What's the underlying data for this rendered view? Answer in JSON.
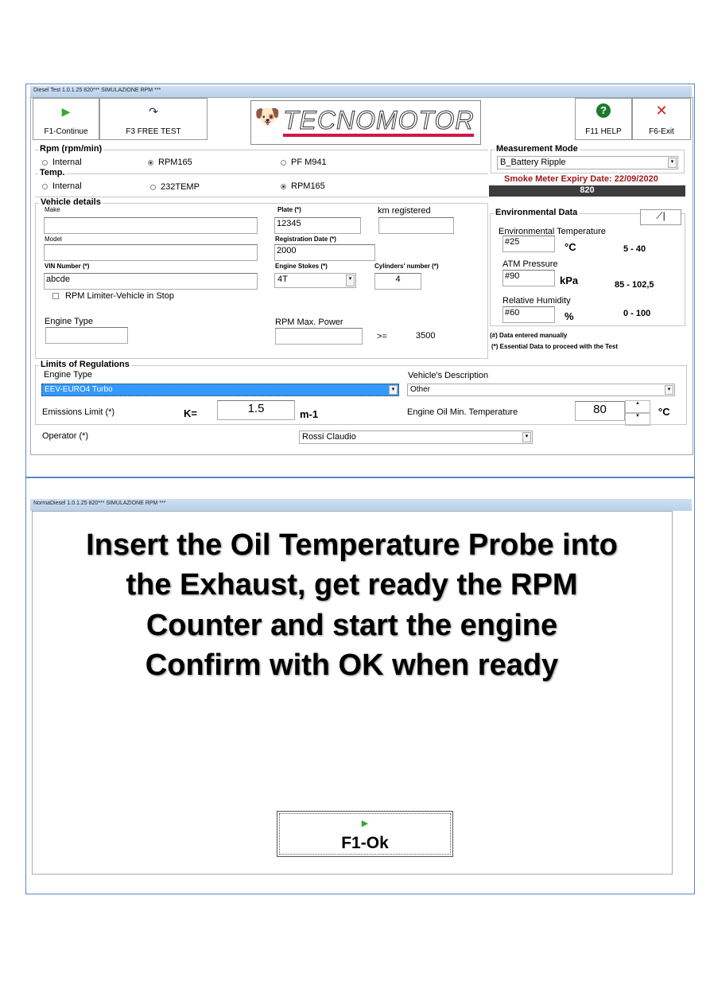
{
  "window1": {
    "title": "Diesel Test 1.0.1.25 820*** SIMULAZIONE RPM ***",
    "toolbar": {
      "continue": "F1-Continue",
      "free_test": "F3 FREE TEST",
      "help": "F11 HELP",
      "exit": "F6-Exit"
    },
    "logo_text": "TECNOMOTOR",
    "rpm": {
      "title": "Rpm (rpm/min)",
      "options": [
        "Internal",
        "RPM165",
        "PF M941"
      ],
      "selected": "RPM165"
    },
    "temp": {
      "title": "Temp.",
      "options": [
        "Internal",
        "232TEMP",
        "RPM165"
      ],
      "selected": "RPM165"
    },
    "measurement": {
      "title": "Measurement Mode",
      "value": "B_Battery Ripple",
      "expiry": "Smoke Meter Expiry Date: 22/09/2020",
      "code": "820"
    },
    "environment": {
      "title": "Environmental Data",
      "temperature": {
        "label": "Environmental Temperature",
        "value": "#25",
        "unit": "°C",
        "range": "5 - 40"
      },
      "pressure": {
        "label": "ATM Pressure",
        "value": "#90",
        "unit": "kPa",
        "range": "85 - 102,5"
      },
      "humidity": {
        "label": "Relative Humidity",
        "value": "#60",
        "unit": "%",
        "range": "0 - 100"
      },
      "note1": "(#) Data entered manually",
      "note2": "(*) Essential Data to proceed with the Test"
    },
    "vehicle": {
      "title": "Vehicle details",
      "make_label": "Make",
      "make": "",
      "model_label": "Model",
      "model": "",
      "vin_label": "VIN Number (*)",
      "vin": "abcde",
      "plate_label": "Plate (*)",
      "plate": "12345",
      "km_label": "km registered",
      "km": "",
      "reg_label": "Registration Date (*)",
      "reg": "2000",
      "strokes_label": "Engine Stokes (*)",
      "strokes": "4T",
      "cyl_label": "Cylinders' number (*)",
      "cyl": "4",
      "limiter_label": "RPM Limiter-Vehicle in Stop",
      "limiter_checked": false,
      "engine_type_label": "Engine Type",
      "engine_type": "",
      "rpm_max_label": "RPM Max. Power",
      "rpm_max": "",
      "gte": ">=",
      "rpm_min": "3500"
    },
    "limits": {
      "title": "Limits of Regulations",
      "engine_type_label": "Engine Type",
      "engine_type": "EEV-EURO4 Turbo",
      "desc_label": "Vehicle's Description",
      "desc": "Other",
      "emissions_label": "Emissions Limit (*)",
      "k": "K=",
      "k_value": "1.5",
      "k_unit": "m-1",
      "oil_label": "Engine Oil Min. Temperature",
      "oil_value": "80",
      "oil_unit": "°C"
    },
    "operator": {
      "label": "Operator (*)",
      "value": "Rossi Claudio"
    }
  },
  "window2": {
    "title": "NormaDiesel 1.0.1.25 820*** SIMULAZIONE RPM ***",
    "message": [
      "Insert the Oil Temperature Probe into",
      "the Exhaust, get ready the RPM",
      "Counter and start the engine",
      "Confirm with OK when ready"
    ],
    "ok": "F1-Ok"
  }
}
